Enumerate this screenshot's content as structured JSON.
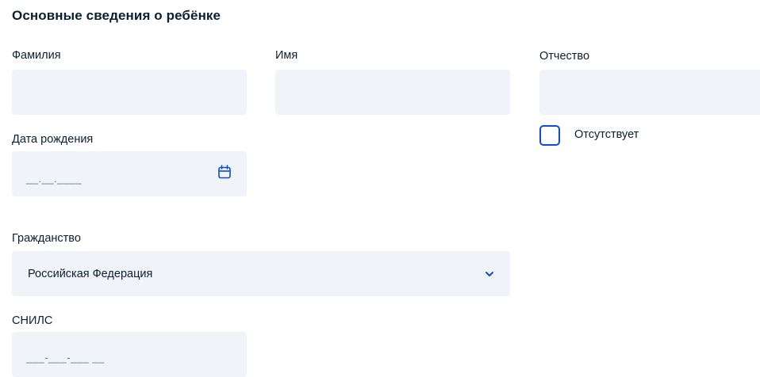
{
  "section": {
    "title": "Основные сведения о ребёнке"
  },
  "fields": {
    "last_name": {
      "label": "Фамилия",
      "value": ""
    },
    "first_name": {
      "label": "Имя",
      "value": ""
    },
    "patronymic": {
      "label": "Отчество",
      "value": ""
    },
    "patronymic_absent": {
      "label": "Отсутствует",
      "checked": false
    },
    "birth_date": {
      "label": "Дата рождения",
      "placeholder": "__.__.____"
    },
    "citizenship": {
      "label": "Гражданство",
      "value": "Российская Федерация"
    },
    "snils": {
      "label": "СНИЛС",
      "placeholder": "___-___-___ __"
    }
  },
  "icons": {
    "calendar": "calendar-icon",
    "dropdown": "chevron-down-icon"
  },
  "colors": {
    "field_background": "#f0f3f7",
    "accent": "#0d4cd3",
    "text": "#0b1f33"
  }
}
